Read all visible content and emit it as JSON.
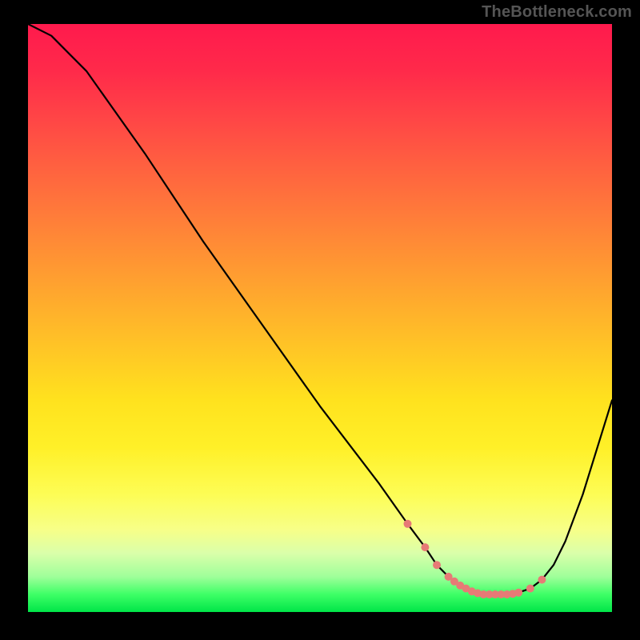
{
  "watermark": "TheBottleneck.com",
  "chart_data": {
    "type": "line",
    "title": "",
    "xlabel": "",
    "ylabel": "",
    "xlim": [
      0,
      100
    ],
    "ylim": [
      0,
      100
    ],
    "series": [
      {
        "name": "bottleneck-curve",
        "x": [
          0,
          4,
          7,
          10,
          20,
          30,
          40,
          50,
          60,
          65,
          68,
          70,
          72,
          74,
          76,
          78,
          80,
          82,
          84,
          86,
          88,
          90,
          92,
          95,
          100
        ],
        "y": [
          100,
          98,
          95,
          92,
          78,
          63,
          49,
          35,
          22,
          15,
          11,
          8,
          6,
          4.5,
          3.5,
          3,
          3,
          3,
          3.3,
          4,
          5.5,
          8,
          12,
          20,
          36
        ]
      }
    ],
    "markers": {
      "name": "optimal-range-dots",
      "color": "#e77a76",
      "x": [
        65,
        68,
        70,
        72,
        73,
        74,
        75,
        76,
        77,
        78,
        79,
        80,
        81,
        82,
        83,
        84,
        86,
        88
      ],
      "y": [
        15,
        11,
        8,
        6,
        5.2,
        4.5,
        4,
        3.5,
        3.2,
        3,
        3,
        3,
        3,
        3,
        3.1,
        3.3,
        4,
        5.5
      ]
    },
    "gradient_stops": [
      {
        "pct": 0,
        "color": "#ff1a4d"
      },
      {
        "pct": 50,
        "color": "#ffc825"
      },
      {
        "pct": 85,
        "color": "#fdfd55"
      },
      {
        "pct": 100,
        "color": "#00e548"
      }
    ]
  }
}
